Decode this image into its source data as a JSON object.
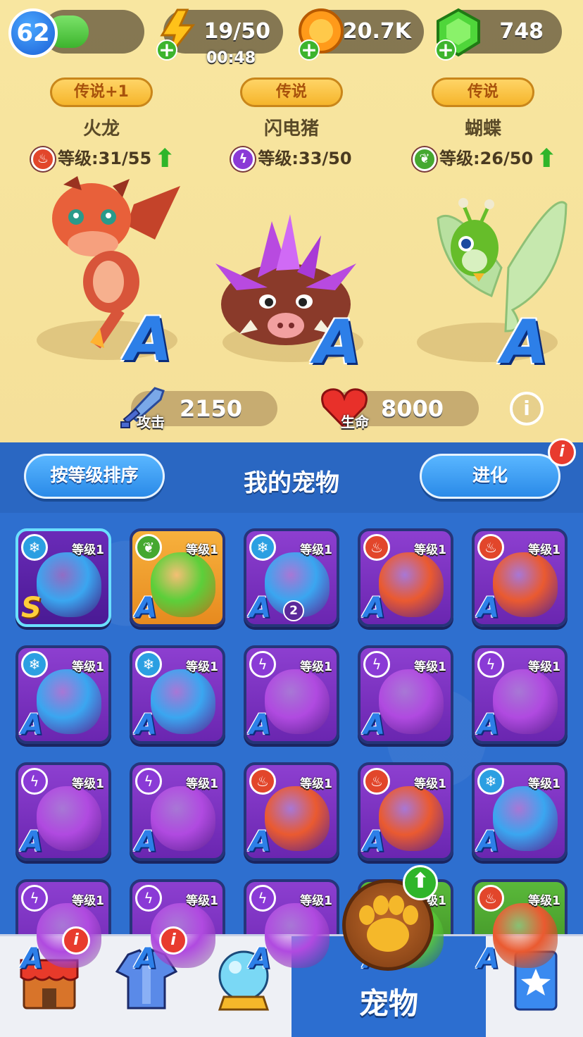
{
  "hud": {
    "player_level": "62",
    "xp_progress": 0.45,
    "energy": "19/50",
    "energy_timer": "00:48",
    "coins": "20.7K",
    "gems": "748"
  },
  "featured": [
    {
      "tier": "传说+1",
      "name": "火龙",
      "level": "等级:31/55",
      "element": "fire",
      "rank": "A"
    },
    {
      "tier": "传说",
      "name": "闪电猪",
      "level": "等级:33/50",
      "element": "bolt",
      "rank": "A"
    },
    {
      "tier": "传说",
      "name": "蝴蝶",
      "level": "等级:26/50",
      "element": "leaf",
      "rank": "A"
    }
  ],
  "stats": {
    "attack_label": "攻击",
    "attack_value": "2150",
    "hp_label": "生命",
    "hp_value": "8000"
  },
  "panel": {
    "sort_button": "按等级排序",
    "title": "我的宠物",
    "evolve_button": "进化",
    "badge": "i"
  },
  "grid": {
    "level_label": "等级1",
    "rank": "A",
    "s_rank": "S",
    "dup_count": "2"
  },
  "nav": {
    "active_label": "宠物",
    "badge": "i"
  },
  "colors": {
    "bg_top": "#f6e39b",
    "panel_blue": "#2a67c2",
    "card_purple": "#7a30c0",
    "rank_blue": "#2d7fe8"
  }
}
